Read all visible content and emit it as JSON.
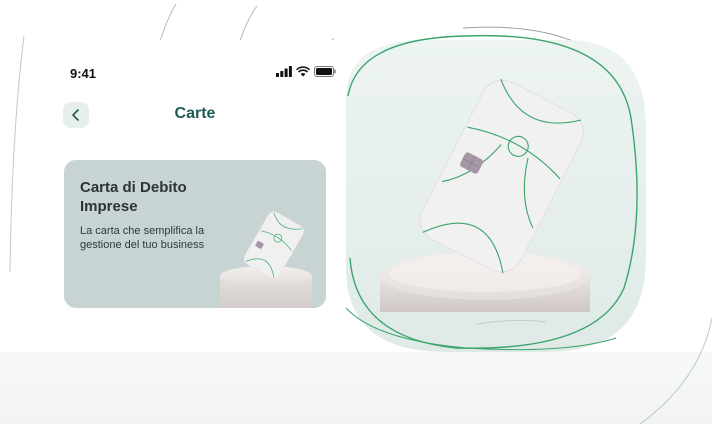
{
  "status_bar": {
    "time": "9:41",
    "icons": [
      "signal-icon",
      "wifi-icon",
      "battery-icon"
    ]
  },
  "nav": {
    "back_icon": "chevron-left-icon",
    "title": "Carte"
  },
  "banner": {
    "title": "Carta di Debito Imprese",
    "description": "La carta che semplifica la gestione del tuo business"
  },
  "colors": {
    "accent": "#1e5c55",
    "line_green": "#2f9e63",
    "banner_bg": "#c7d4d3",
    "back_bg": "#e6efec"
  }
}
